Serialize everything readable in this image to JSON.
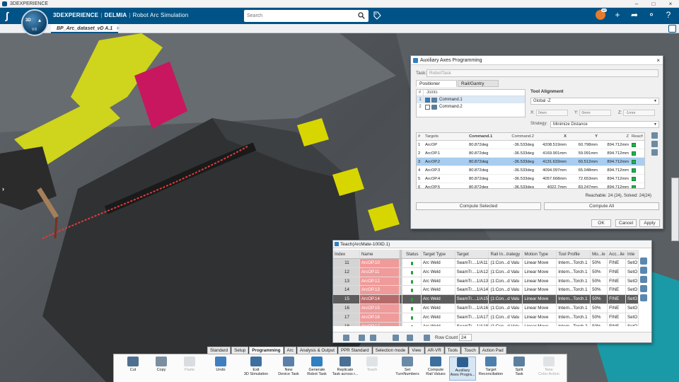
{
  "os_window": {
    "title": "3DEXPERIENCE"
  },
  "header": {
    "brand_3dx": "3DEXPERIENCE",
    "brand_delmia": "DELMIA",
    "app_name": "Robot Arc Simulation",
    "search_placeholder": "Search",
    "compass_version": "V.6",
    "avatar_badge": "RP"
  },
  "tab_strip": {
    "doc_tab": "BP_Arc_dataset_vD A.1",
    "add_label": "+"
  },
  "aux_dialog": {
    "title": "Auxiliary Axes Programming",
    "task_label": "Task:",
    "task_value": "RobotTask",
    "tabs": [
      "Positioner",
      "Rail/Gantry"
    ],
    "joints_header": [
      "#",
      "Joints"
    ],
    "joints": [
      {
        "n": "1",
        "name": "Command.1",
        "checked": true
      },
      {
        "n": "2",
        "name": "Command.2",
        "checked": false
      }
    ],
    "tool_alignment_label": "Tool Alignment",
    "tool_alignment_value": "Global -Z",
    "x_label": "X:",
    "x_value": "0mm",
    "y_label": "Y:",
    "y_value": "0mm",
    "z_label": "Z:",
    "z_value": "-1mm",
    "strategy_label": "Strategy:",
    "strategy_value": "Minimize Distance",
    "targets_header": [
      "#",
      "Targets",
      "Command.1",
      "Command.2",
      "X",
      "Y",
      "Z",
      "Reach"
    ],
    "targets": [
      {
        "n": "1",
        "t": "ArcOP",
        "c1": "80.872deg",
        "c2": "-36.533deg",
        "x": "4208.519mm",
        "y": "60.798mm",
        "z": "894.712mm"
      },
      {
        "n": "2",
        "t": "ArcOP.1",
        "c1": "80.872deg",
        "c2": "-36.533deg",
        "x": "4169.901mm",
        "y": "59.091mm",
        "z": "894.712mm"
      },
      {
        "n": "3",
        "t": "ArcOP.2",
        "c1": "80.872deg",
        "c2": "-36.533deg",
        "x": "4131.633mm",
        "y": "60.512mm",
        "z": "894.712mm"
      },
      {
        "n": "4",
        "t": "ArcOP.3",
        "c1": "80.872deg",
        "c2": "-36.533deg",
        "x": "4094.097mm",
        "y": "65.048mm",
        "z": "894.712mm"
      },
      {
        "n": "5",
        "t": "ArcOP.4",
        "c1": "80.872deg",
        "c2": "-36.533deg",
        "x": "4057.668mm",
        "y": "72.653mm",
        "z": "894.712mm"
      },
      {
        "n": "6",
        "t": "ArcOP.5",
        "c1": "80.872deg",
        "c2": "-36.533deg",
        "x": "4022.7mm",
        "y": "83.247mm",
        "z": "894.712mm"
      }
    ],
    "reach_status": "Reachable: 24 (24), Solved: 24(24)",
    "compute_selected": "Compute Selected",
    "compute_all": "Compute All",
    "ok": "OK",
    "cancel": "Cancel",
    "apply": "Apply"
  },
  "teach": {
    "title": "Teach(ArcMate-100iD.1)",
    "columns": [
      "Index",
      "Name",
      "Status",
      "Target Type",
      "Target",
      "Rail In...trategy",
      "Motion Type",
      "Tool Profile",
      "Mo...le",
      "Acc...ile",
      "Inte"
    ],
    "rows": [
      {
        "idx": "11",
        "name": "ArcOP.10",
        "tt": "Arc Weld",
        "tg": "SeamTr....1/A11",
        "ri": "(1:Con...d Valu",
        "mt": "Linear Move",
        "tp": "Intern...Torch.1",
        "mo": "50%",
        "ac": "FINE",
        "in": "SetO"
      },
      {
        "idx": "12",
        "name": "ArcOP.11",
        "tt": "Arc Weld",
        "tg": "SeamTr....1/A12",
        "ri": "(1:Con...d Valu",
        "mt": "Linear Move",
        "tp": "Intern...Torch.1",
        "mo": "50%",
        "ac": "FINE",
        "in": "SetO"
      },
      {
        "idx": "13",
        "name": "ArcOP.12",
        "tt": "Arc Weld",
        "tg": "SeamTr....1/A13",
        "ri": "(1:Con...d Valu",
        "mt": "Linear Move",
        "tp": "Intern...Torch.1",
        "mo": "50%",
        "ac": "FINE",
        "in": "SetO"
      },
      {
        "idx": "14",
        "name": "ArcOP.13",
        "tt": "Arc Weld",
        "tg": "SeamTr....1/A14",
        "ri": "(1:Con...d Valu",
        "mt": "Linear Move",
        "tp": "Intern...Torch.1",
        "mo": "50%",
        "ac": "FINE",
        "in": "SetO"
      },
      {
        "idx": "15",
        "name": "ArcOP.14",
        "tt": "Arc Weld",
        "tg": "SeamTr....1/A15",
        "ri": "(1:Con...d Valu",
        "mt": "Linear Move",
        "tp": "Intern...Torch.1",
        "mo": "50%",
        "ac": "FINE",
        "in": "SetO"
      },
      {
        "idx": "16",
        "name": "ArcOP.15",
        "tt": "Arc Weld",
        "tg": "SeamTr....1/A16",
        "ri": "(1:Con...d Valu",
        "mt": "Linear Move",
        "tp": "Intern...Torch.1",
        "mo": "50%",
        "ac": "FINE",
        "in": "SetO"
      },
      {
        "idx": "17",
        "name": "ArcOP.16",
        "tt": "Arc Weld",
        "tg": "SeamTr....1/A17",
        "ri": "(1:Con...d Valu",
        "mt": "Linear Move",
        "tp": "Intern...Torch.1",
        "mo": "50%",
        "ac": "FINE",
        "in": "SetO"
      },
      {
        "idx": "18",
        "name": "ArcOP.17",
        "tt": "Arc Weld",
        "tg": "SeamTr....1/A18",
        "ri": "(1:Con...d Valu",
        "mt": "Linear Move",
        "tp": "Intern...Torch.2",
        "mo": "50%",
        "ac": "FINE",
        "in": "SetO"
      }
    ],
    "highlight_index": "15",
    "row_count_label": "Row Count",
    "row_count": "24"
  },
  "ribbon_tabs": [
    "Standard",
    "Setup",
    "Programming",
    "Arc",
    "Analysis & Output",
    "PPR Standard",
    "Selection mode",
    "View",
    "AR-VR",
    "Tools",
    "Touch",
    "Action Pad"
  ],
  "ribbon_active": "Programming",
  "ribbon_buttons": [
    {
      "id": "cut",
      "label": "Cut",
      "l2": "",
      "icon": "scissors-icon"
    },
    {
      "id": "copy",
      "label": "Copy",
      "l2": "",
      "icon": "copy-icon"
    },
    {
      "id": "paste",
      "label": "Paste",
      "l2": "",
      "icon": "paste-icon"
    },
    {
      "id": "undo",
      "label": "Undo",
      "l2": "",
      "icon": "undo-icon"
    },
    {
      "id": "exit",
      "label": "Exit",
      "l2": "3D Simulation",
      "icon": "exit-icon"
    },
    {
      "id": "new-device-task",
      "label": "New",
      "l2": "Device Task",
      "icon": "new-task-icon"
    },
    {
      "id": "generate",
      "label": "Generate",
      "l2": "Robot Task",
      "icon": "generate-icon"
    },
    {
      "id": "replicate",
      "label": "Replicate",
      "l2": "Task across r...",
      "icon": "replicate-icon"
    },
    {
      "id": "teach",
      "label": "Teach",
      "l2": "",
      "icon": "teach-icon"
    },
    {
      "id": "set-turn",
      "label": "Set",
      "l2": "TurnNumbers",
      "icon": "set-turn-icon"
    },
    {
      "id": "compute-rail",
      "label": "Compute",
      "l2": "Rail Values",
      "icon": "compute-rail-icon"
    },
    {
      "id": "aux-prog",
      "label": "Auxiliary",
      "l2": "Axes Progra...",
      "icon": "aux-axes-icon"
    },
    {
      "id": "target-recon",
      "label": "Target",
      "l2": "Reconciliation",
      "icon": "target-recon-icon"
    },
    {
      "id": "split",
      "label": "Split",
      "l2": "Task",
      "icon": "split-icon"
    },
    {
      "id": "new-color",
      "label": "New",
      "l2": "Color Action",
      "icon": "color-action-icon"
    }
  ],
  "colors": {
    "brand_blue": "#005386",
    "robot_yellow": "#d6dc1d",
    "gripper_magenta": "#c8175e",
    "weld_path_red": "#e23b3b",
    "name_cell_red": "#f09a9a",
    "selection_blue": "#a8cdf0",
    "reach_green": "#22b14c"
  }
}
